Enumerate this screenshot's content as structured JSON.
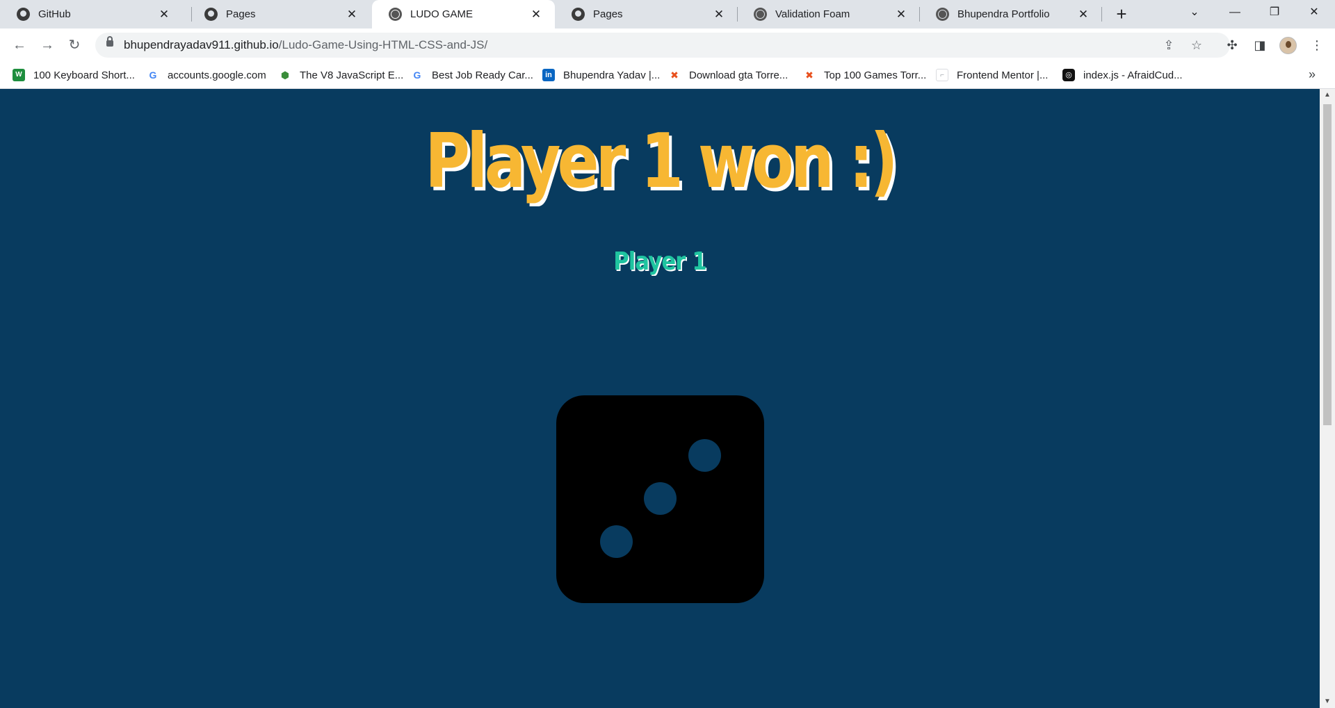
{
  "tabs": [
    {
      "title": "GitHub",
      "icon": "github-icon",
      "active": false
    },
    {
      "title": "Pages",
      "icon": "github-icon",
      "active": false
    },
    {
      "title": "LUDO GAME",
      "icon": "globe-icon",
      "active": true
    },
    {
      "title": "Pages",
      "icon": "github-icon",
      "active": false
    },
    {
      "title": "Validation Foam",
      "icon": "globe-icon",
      "active": false
    },
    {
      "title": "Bhupendra Portfolio",
      "icon": "globe-icon",
      "active": false
    }
  ],
  "toolbar": {
    "url_host": "bhupendrayadav911.github.io",
    "url_path": "/Ludo-Game-Using-HTML-CSS-and-JS/"
  },
  "bookmarks": [
    {
      "label": "100 Keyboard Short...",
      "icon": "wn-icon",
      "color": "#1e8e3e"
    },
    {
      "label": "accounts.google.com",
      "icon": "google-icon",
      "color": "#4285f4"
    },
    {
      "label": "The V8 JavaScript E...",
      "icon": "v8-icon",
      "color": "#3a8d3a"
    },
    {
      "label": "Best Job Ready Car...",
      "icon": "google-icon",
      "color": "#4285f4"
    },
    {
      "label": "Bhupendra Yadav |...",
      "icon": "linkedin-icon",
      "color": "#0a66c2"
    },
    {
      "label": "Download gta Torre...",
      "icon": "x-icon",
      "color": "#e8501d"
    },
    {
      "label": "Top 100 Games Torr...",
      "icon": "x-icon",
      "color": "#e8501d"
    },
    {
      "label": "Frontend Mentor |...",
      "icon": "frontend-mentor-icon",
      "color": "#9aa0a6"
    },
    {
      "label": "index.js - AfraidCud...",
      "icon": "replit-icon",
      "color": "#111111"
    }
  ],
  "game": {
    "result_title": "Player 1 won :)",
    "current_player": "Player 1",
    "dice_value": 3,
    "colors": {
      "background": "#083b5f",
      "title": "#f7b733",
      "player": "#1fc4a0",
      "dice": "#000000"
    }
  }
}
